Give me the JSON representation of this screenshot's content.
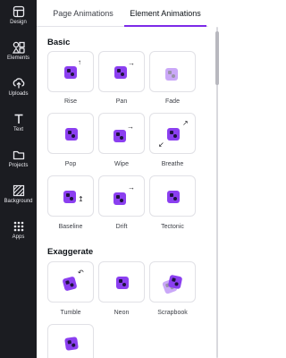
{
  "sidebar": {
    "items": [
      {
        "label": "Design",
        "icon": "design-icon"
      },
      {
        "label": "Elements",
        "icon": "elements-icon"
      },
      {
        "label": "Uploads",
        "icon": "upload-icon"
      },
      {
        "label": "Text",
        "icon": "text-icon"
      },
      {
        "label": "Projects",
        "icon": "folder-icon"
      },
      {
        "label": "Background",
        "icon": "background-icon"
      },
      {
        "label": "Apps",
        "icon": "apps-icon"
      }
    ]
  },
  "tabs": {
    "page": "Page Animations",
    "element": "Element Animations",
    "active": "element"
  },
  "sections": {
    "basic": {
      "title": "Basic",
      "items": [
        "Rise",
        "Pan",
        "Fade",
        "Pop",
        "Wipe",
        "Breathe",
        "Baseline",
        "Drift",
        "Tectonic"
      ]
    },
    "exaggerate": {
      "title": "Exaggerate",
      "items": [
        "Tumble",
        "Neon",
        "Scrapbook"
      ]
    }
  },
  "colors": {
    "accent": "#7d2ae8",
    "tile": "#8b3ff0",
    "rail": "#1b1c21"
  }
}
